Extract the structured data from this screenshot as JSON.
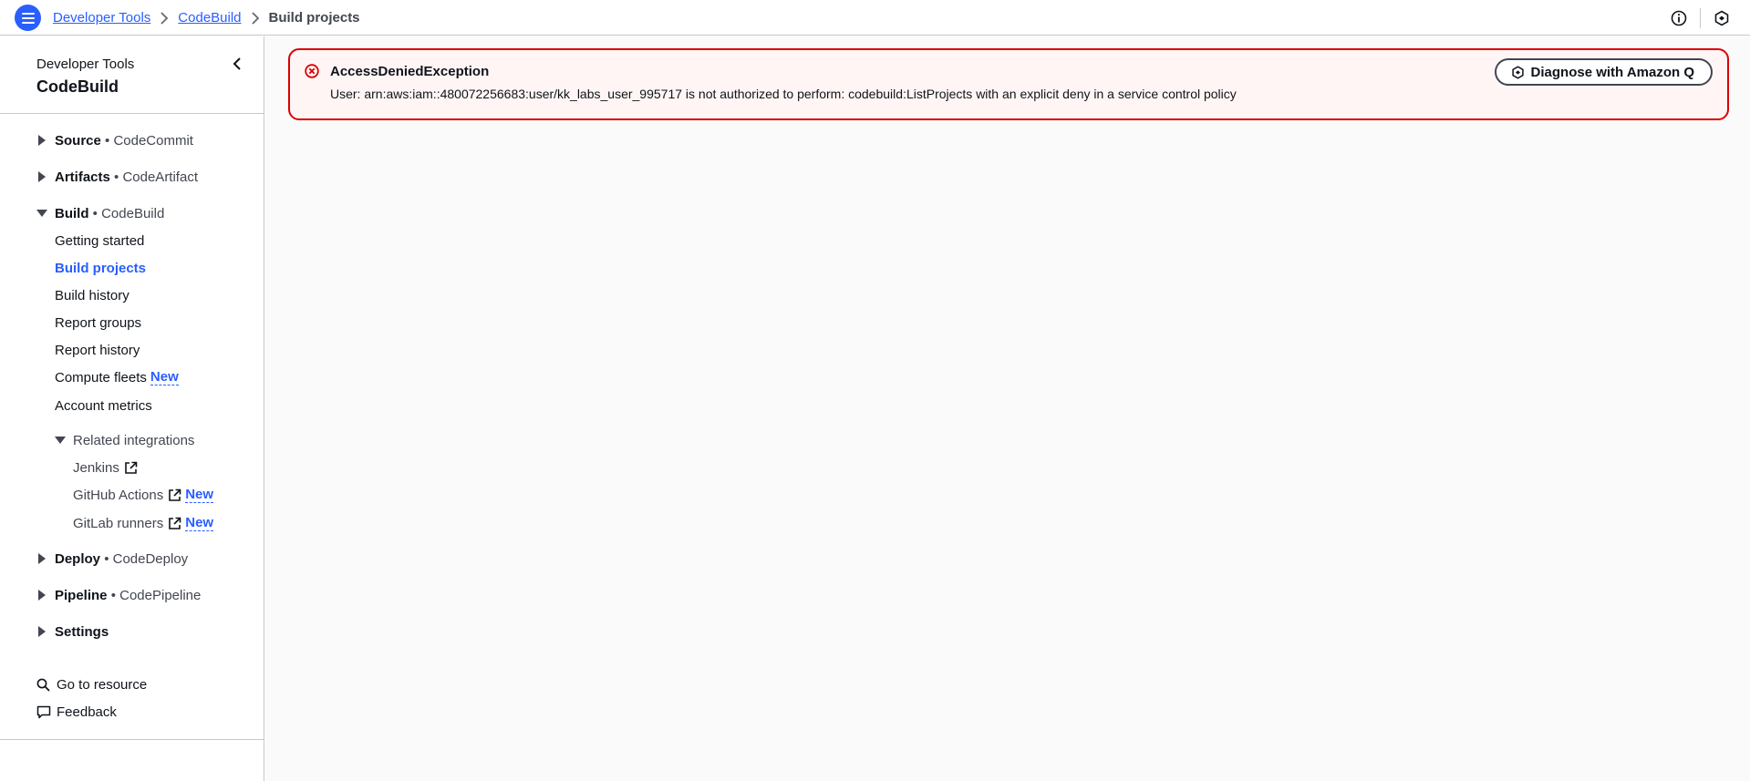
{
  "breadcrumbs": {
    "items": [
      "Developer Tools",
      "CodeBuild"
    ],
    "current": "Build projects"
  },
  "sidebar": {
    "parent": "Developer Tools",
    "title": "CodeBuild",
    "sections": {
      "source": {
        "label": "Source",
        "sub": "• CodeCommit"
      },
      "artifacts": {
        "label": "Artifacts",
        "sub": "• CodeArtifact"
      },
      "build": {
        "label": "Build",
        "sub": "• CodeBuild"
      },
      "deploy": {
        "label": "Deploy",
        "sub": "• CodeDeploy"
      },
      "pipeline": {
        "label": "Pipeline",
        "sub": "• CodePipeline"
      },
      "settings": {
        "label": "Settings"
      }
    },
    "build_items": [
      "Getting started",
      "Build projects",
      "Build history",
      "Report groups",
      "Report history",
      "Compute fleets",
      "Account metrics"
    ],
    "related": {
      "label": "Related integrations",
      "items": [
        "Jenkins",
        "GitHub Actions",
        "GitLab runners"
      ]
    },
    "new_badge": "New",
    "utilities": [
      "Go to resource",
      "Feedback"
    ]
  },
  "alert": {
    "title": "AccessDeniedException",
    "message": "User: arn:aws:iam::480072256683:user/kk_labs_user_995717 is not authorized to perform: codebuild:ListProjects with an explicit deny in a service control policy",
    "button": "Diagnose with Amazon Q"
  },
  "colors": {
    "accent": "#295eff",
    "error": "#db0000",
    "error_bg": "#fff5f5"
  }
}
